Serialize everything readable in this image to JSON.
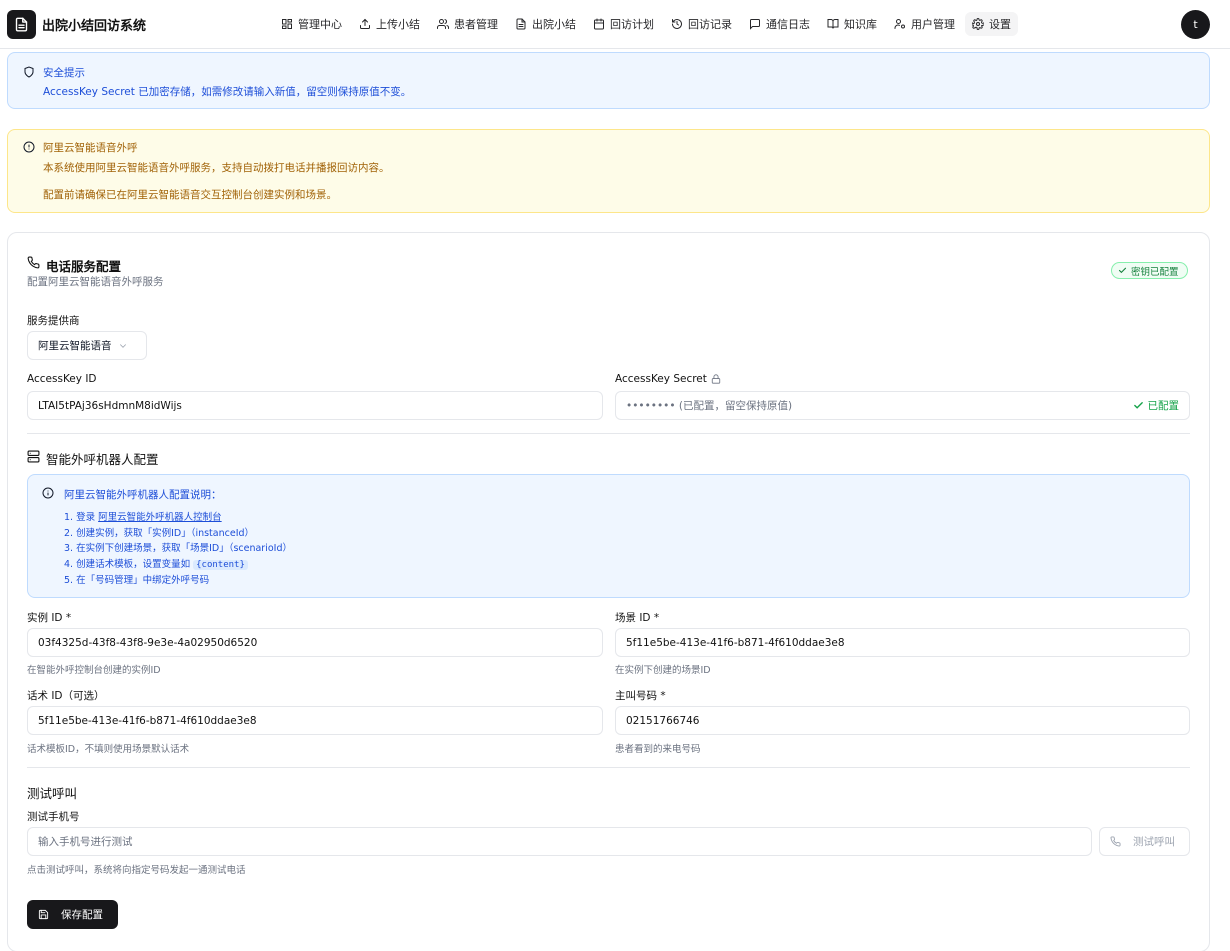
{
  "app": {
    "title": "出院小结回访系统",
    "user_initial": "t"
  },
  "nav": {
    "items": [
      {
        "label": "管理中心",
        "icon": "dashboard-icon"
      },
      {
        "label": "上传小结",
        "icon": "upload-icon"
      },
      {
        "label": "患者管理",
        "icon": "users-icon"
      },
      {
        "label": "出院小结",
        "icon": "document-icon"
      },
      {
        "label": "回访计划",
        "icon": "calendar-icon"
      },
      {
        "label": "回访记录",
        "icon": "history-icon"
      },
      {
        "label": "通信日志",
        "icon": "message-icon"
      },
      {
        "label": "知识库",
        "icon": "book-icon"
      },
      {
        "label": "用户管理",
        "icon": "user-cog-icon"
      },
      {
        "label": "设置",
        "icon": "gear-icon",
        "active": true
      }
    ]
  },
  "security_alert": {
    "title": "安全提示",
    "message": "AccessKey Secret 已加密存储，如需修改请输入新值，留空则保持原值不变。"
  },
  "aliyun_alert": {
    "title": "阿里云智能语音外呼",
    "line1": "本系统使用阿里云智能语音外呼服务，支持自动拨打电话并播报回访内容。",
    "line2": "配置前请确保已在阿里云智能语音交互控制台创建实例和场景。"
  },
  "config": {
    "title": "电话服务配置",
    "subtitle": "配置阿里云智能语音外呼服务",
    "badge": "密钥已配置",
    "provider_label": "服务提供商",
    "provider_value": "阿里云智能语音",
    "access_key_id_label": "AccessKey ID",
    "access_key_id_value": "LTAI5tPAj36sHdmnM8idWijs",
    "access_key_secret_label": "AccessKey Secret",
    "access_key_secret_placeholder": "•••••••• (已配置，留空保持原值)",
    "access_key_secret_status": "已配置"
  },
  "robot": {
    "title": "智能外呼机器人配置",
    "info_title": "阿里云智能外呼机器人配置说明：",
    "step1_prefix": "1. 登录",
    "step1_link": "阿里云智能外呼机器人控制台",
    "step2": "2. 创建实例，获取「实例ID」（instanceId）",
    "step3": "3. 在实例下创建场景，获取「场景ID」（scenarioId）",
    "step4_prefix": "4. 创建话术模板，设置变量如",
    "step4_code": "{content}",
    "step5": "5. 在「号码管理」中绑定外呼号码",
    "instance_label": "实例 ID *",
    "instance_value": "03f4325d-43f8-43f8-9e3e-4a02950d6520",
    "instance_hint": "在智能外呼控制台创建的实例ID",
    "scenario_label": "场景 ID *",
    "scenario_value": "5f11e5be-413e-41f6-b871-4f610ddae3e8",
    "scenario_hint": "在实例下创建的场景ID",
    "script_label": "话术 ID（可选）",
    "script_value": "5f11e5be-413e-41f6-b871-4f610ddae3e8",
    "script_hint": "话术模板ID，不填则使用场景默认话术",
    "caller_label": "主叫号码 *",
    "caller_value": "02151766746",
    "caller_hint": "患者看到的来电号码"
  },
  "test": {
    "title": "测试呼叫",
    "phone_label": "测试手机号",
    "phone_placeholder": "输入手机号进行测试",
    "button": "测试呼叫",
    "hint": "点击测试呼叫，系统将向指定号码发起一通测试电话"
  },
  "save_button": "保存配置"
}
